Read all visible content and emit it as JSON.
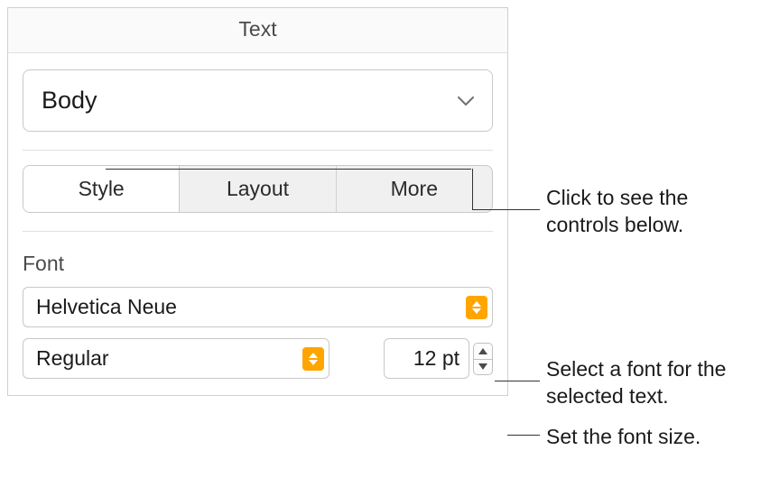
{
  "header": {
    "title": "Text"
  },
  "paragraph_style": {
    "selected": "Body"
  },
  "tabs": {
    "items": [
      "Style",
      "Layout",
      "More"
    ],
    "active_index": 0
  },
  "font_section": {
    "label": "Font",
    "family": "Helvetica Neue",
    "typeface": "Regular",
    "size": "12 pt"
  },
  "callouts": {
    "tabs_hint": "Click to see the controls below.",
    "font_hint": "Select a font for the selected text.",
    "size_hint": "Set the font size."
  }
}
